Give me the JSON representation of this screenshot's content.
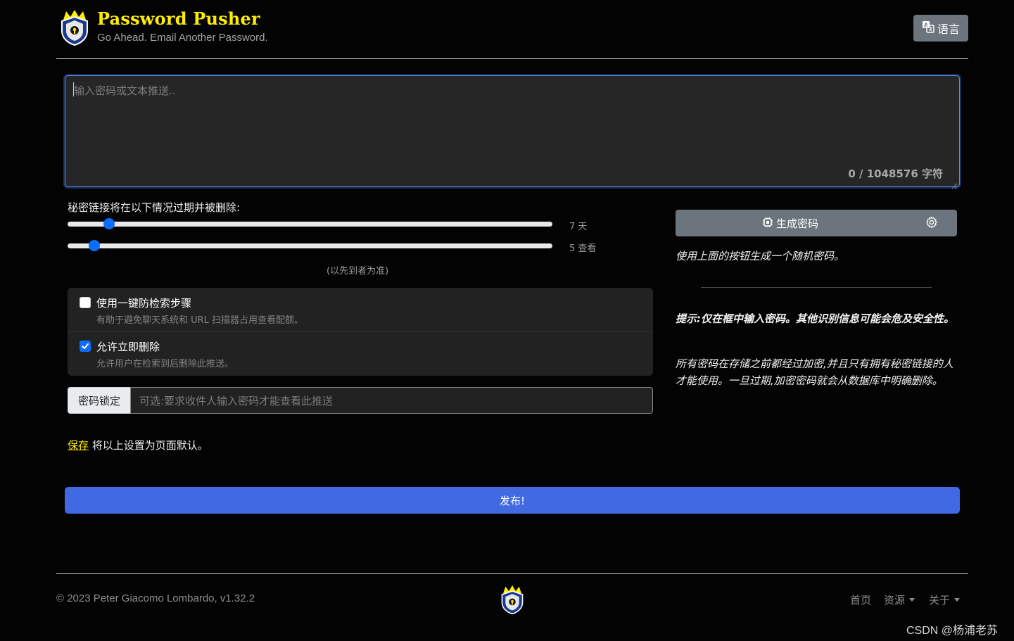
{
  "header": {
    "title": "Password Pusher",
    "tagline": "Go Ahead. Email Another Password.",
    "language_button": "语言"
  },
  "payload": {
    "placeholder": "输入密码或文本推送..",
    "char_count": "0 / 1048576 字符"
  },
  "expiration": {
    "label": "秘密链接将在以下情况过期并被删除:",
    "days": {
      "value_label": "7 天",
      "fraction": 0.08
    },
    "views": {
      "value_label": "5 查看",
      "fraction": 0.05
    },
    "note": "(以先到者为准)"
  },
  "options": [
    {
      "title": "使用一键防检索步骤",
      "description": "有助于避免聊天系统和 URL 扫描器占用查看配额。",
      "checked": false
    },
    {
      "title": "允许立即删除",
      "description": "允许用户在检索到后删除此推送。",
      "checked": true
    }
  ],
  "passphrase": {
    "label": "密码锁定",
    "placeholder": "可选:要求收件人输入密码才能查看此推送"
  },
  "save_defaults": {
    "link": "保存",
    "text": " 将以上设置为页面默认。"
  },
  "publish_button": "发布!",
  "generator": {
    "button": "生成密码",
    "hint": "使用上面的按钮生成一个随机密码。"
  },
  "tips": {
    "tip": "提示:仅在框中输入密码。其他识别信息可能会危及安全性。",
    "encryption": "所有密码在存储之前都经过加密,并且只有拥有秘密链接的人才能使用。一旦过期,加密密码就会从数据库中明确删除。"
  },
  "footer": {
    "copyright": "© 2023 Peter Giacomo Lombardo, v1.32.2",
    "links": [
      "首页",
      "资源",
      "关于"
    ]
  },
  "watermark": "CSDN @杨浦老苏",
  "colors": {
    "brand": "#ffee00",
    "primary": "#4169e1",
    "accent": "#0d6efd",
    "secondary": "#6c757d"
  }
}
